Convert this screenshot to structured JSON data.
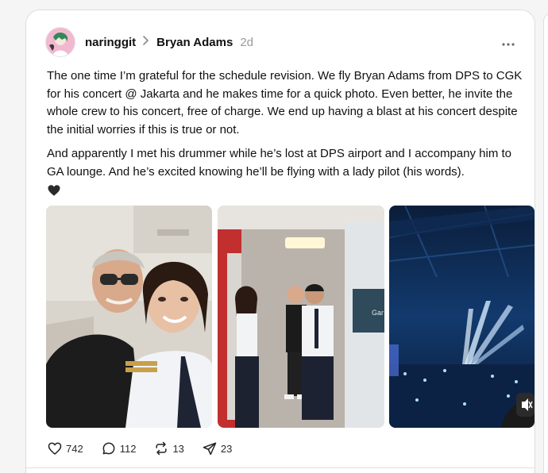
{
  "post": {
    "username": "naringgit",
    "topic": "Bryan Adams",
    "time": "2d",
    "more_label": "•••",
    "paragraphs": [
      "The one time I’m grateful for the schedule revision. We fly Bryan Adams from DPS to CGK for his concert @ Jakarta and he makes time for a quick photo. Even better, he invite the whole crew to his concert, free of charge. We end up having a blast at his concert despite the initial worries if this is true or not.",
      "And apparently I met his drummer while he’s lost at DPS airport and I accompany him to GA lounge. And he’s excited knowing he’ll be flying with a lady pilot (his words)."
    ],
    "emoji": "black-heart-emoji",
    "photo2_sign": "Gar",
    "images": [
      {
        "name": "selfie-photo"
      },
      {
        "name": "cabin-crew-photo"
      },
      {
        "name": "concert-photo"
      }
    ],
    "actions": {
      "likes": "742",
      "replies": "112",
      "reposts": "13",
      "shares": "23"
    }
  },
  "colors": {
    "text": "#111111",
    "muted": "#9a9a9a",
    "border": "#dedede",
    "concert_blue": "#1f5fb8"
  }
}
